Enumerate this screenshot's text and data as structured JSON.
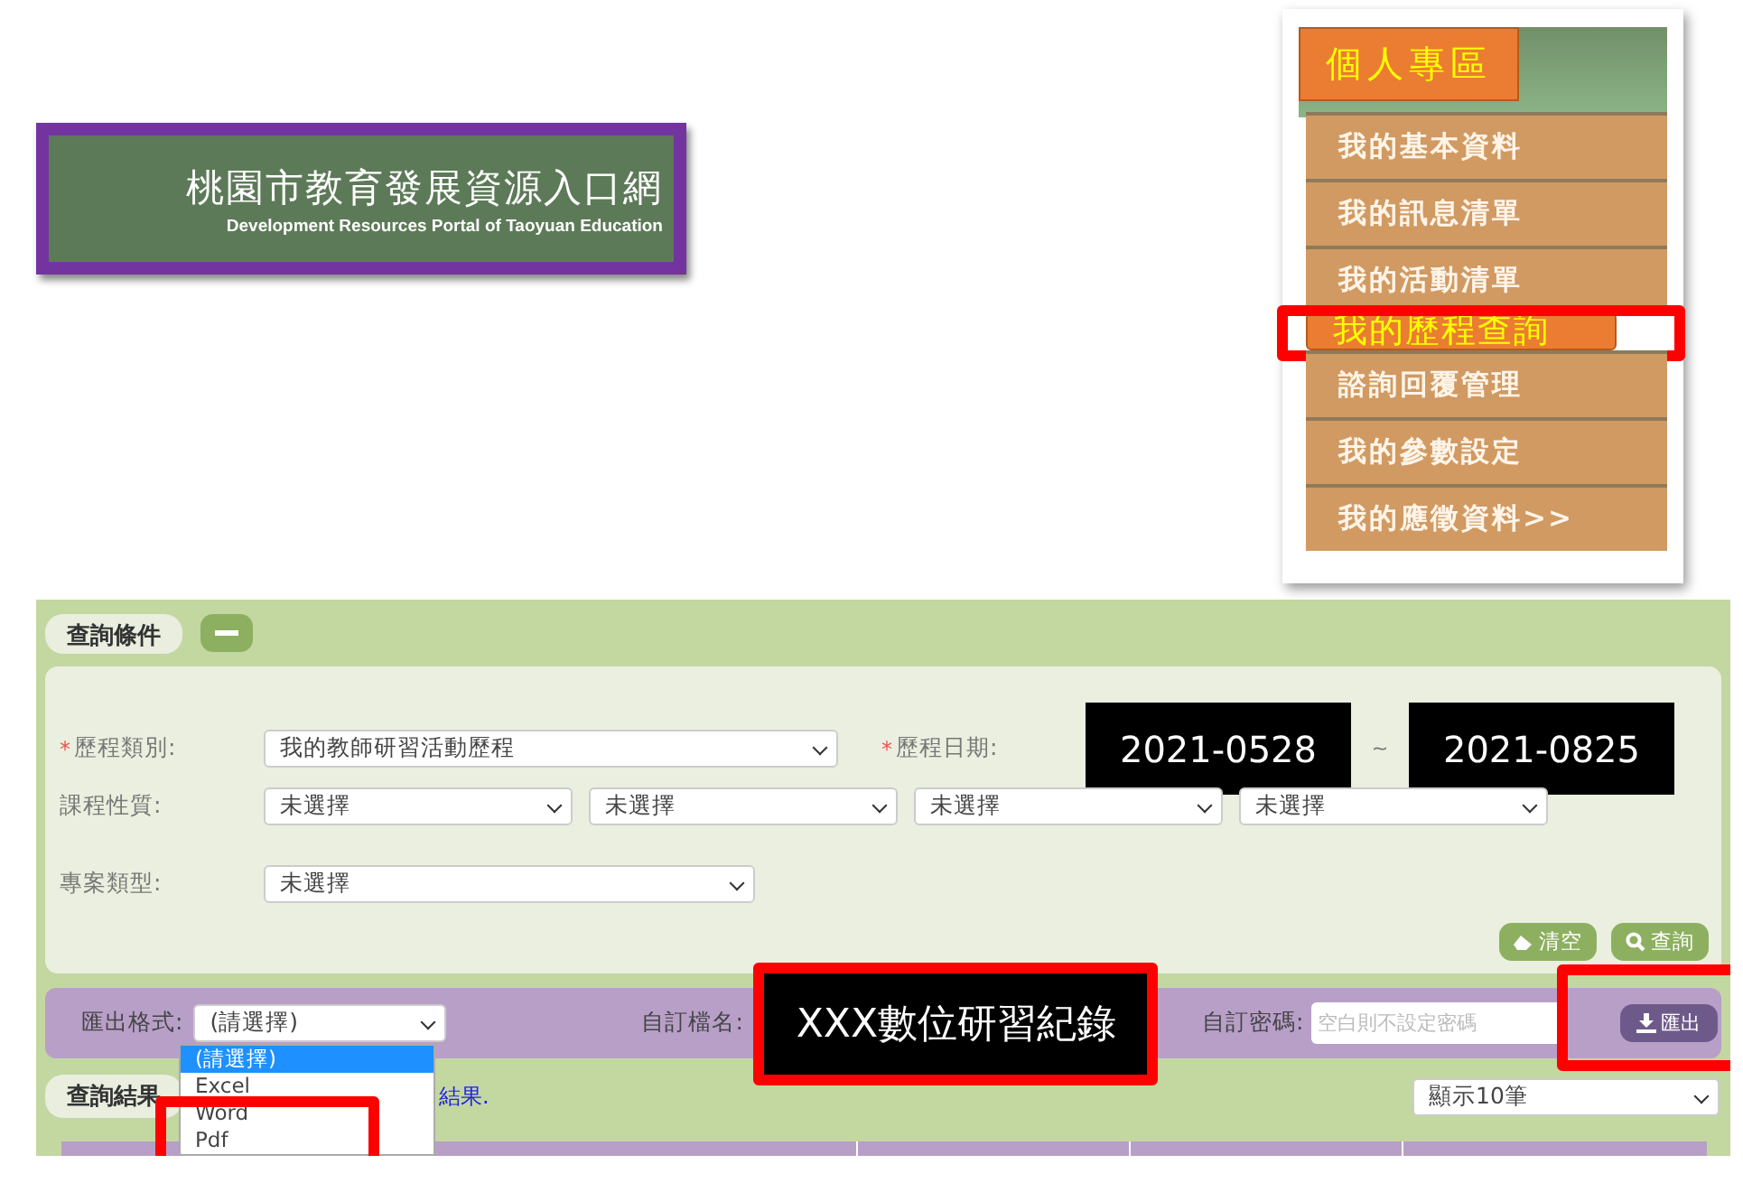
{
  "logo": {
    "title": "桃園市教育發展資源入口網",
    "subtitle": "Development Resources Portal of Taoyuan Education"
  },
  "menu": {
    "title": "個人專區",
    "items": [
      {
        "label": "我的基本資料",
        "selected": false
      },
      {
        "label": "我的訊息清單",
        "selected": false
      },
      {
        "label": "我的活動清單",
        "selected": false
      },
      {
        "label": "我的歷程查詢",
        "selected": true
      },
      {
        "label": "諮詢回覆管理",
        "selected": false
      },
      {
        "label": "我的參數設定",
        "selected": false
      },
      {
        "label": "我的應徵資料>>",
        "selected": false
      }
    ]
  },
  "query": {
    "tab": "查詢條件",
    "type": {
      "marker": "*",
      "label": "歷程類別:",
      "value": "我的教師研習活動歷程"
    },
    "date": {
      "marker": "*",
      "label": "歷程日期:",
      "from": "2021-0528",
      "separator": "~",
      "to": "2021-0825"
    },
    "course": {
      "label": "課程性質:",
      "values": [
        "未選擇",
        "未選擇",
        "未選擇",
        "未選擇"
      ]
    },
    "project": {
      "label": "專案類型:",
      "value": "未選擇"
    },
    "buttons": [
      {
        "label": "清空",
        "kind": "clear"
      },
      {
        "label": "查詢",
        "kind": "search"
      }
    ]
  },
  "export": {
    "format_label": "匯出格式:",
    "format_value": "(請選擇)",
    "options": [
      {
        "label": "(請選擇)",
        "selected": true
      },
      {
        "label": "Excel",
        "selected": false
      },
      {
        "label": "Word",
        "selected": false
      },
      {
        "label": "Pdf",
        "selected": false
      }
    ],
    "filename_label": "自訂檔名:",
    "filename": "XXX數位研習紀錄",
    "password_label": "自訂密碼:",
    "password_placeholder": "空白則不設定密碼",
    "button": "匯出"
  },
  "results": {
    "tab": "查詢結果",
    "note": "結果.",
    "page_size": "顯示10筆"
  }
}
